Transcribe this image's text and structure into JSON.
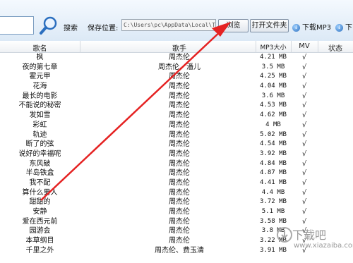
{
  "toolbar": {
    "search_label": "搜索",
    "path_label": "保存位置:",
    "path_value": "C:\\Users\\pc\\AppData\\Local\\Tem",
    "browse_label": "浏览",
    "open_folder_label": "打开文件夹",
    "download_mp3_label": "下载MP3",
    "download_mv_label": "下"
  },
  "columns": {
    "name": "歌名",
    "singer": "歌手",
    "size": "MP3大小",
    "mv": "MV",
    "status": "状态"
  },
  "songs": [
    {
      "name": "枫",
      "singer": "周杰伦",
      "size": "4.21 MB",
      "mv": "√"
    },
    {
      "name": "夜的第七章",
      "singer": "周杰伦、潘儿",
      "size": "3.5 MB",
      "mv": "√"
    },
    {
      "name": "霍元甲",
      "singer": "周杰伦",
      "size": "4.25 MB",
      "mv": "√"
    },
    {
      "name": "花海",
      "singer": "周杰伦",
      "size": "4.04 MB",
      "mv": "√"
    },
    {
      "name": "最长的电影",
      "singer": "周杰伦",
      "size": "3.6 MB",
      "mv": "√"
    },
    {
      "name": "不能说的秘密",
      "singer": "周杰伦",
      "size": "4.53 MB",
      "mv": "√"
    },
    {
      "name": "发如雪",
      "singer": "周杰伦",
      "size": "4.62 MB",
      "mv": "√"
    },
    {
      "name": "彩虹",
      "singer": "周杰伦",
      "size": "4 MB",
      "mv": "√"
    },
    {
      "name": "轨迹",
      "singer": "周杰伦",
      "size": "5.02 MB",
      "mv": "√"
    },
    {
      "name": "断了的弦",
      "singer": "周杰伦",
      "size": "4.54 MB",
      "mv": "√"
    },
    {
      "name": "说好的幸福呢",
      "singer": "周杰伦",
      "size": "3.92 MB",
      "mv": "√"
    },
    {
      "name": "东风破",
      "singer": "周杰伦",
      "size": "4.84 MB",
      "mv": "√"
    },
    {
      "name": "半岛铁盒",
      "singer": "周杰伦",
      "size": "4.87 MB",
      "mv": "√"
    },
    {
      "name": "我不配",
      "singer": "周杰伦",
      "size": "4.41 MB",
      "mv": "√"
    },
    {
      "name": "算什么男人",
      "singer": "周杰伦",
      "size": "4.4 MB",
      "mv": "√"
    },
    {
      "name": "甜甜的",
      "singer": "周杰伦",
      "size": "3.72 MB",
      "mv": "√"
    },
    {
      "name": "安静",
      "singer": "周杰伦",
      "size": "5.1 MB",
      "mv": "√"
    },
    {
      "name": "爱在西元前",
      "singer": "周杰伦",
      "size": "3.58 MB",
      "mv": "√"
    },
    {
      "name": "园游会",
      "singer": "周杰伦",
      "size": "3.8 MB",
      "mv": "√"
    },
    {
      "name": "本草纲目",
      "singer": "周杰伦",
      "size": "3.22 MB",
      "mv": "√"
    },
    {
      "name": "千里之外",
      "singer": "周杰伦、费玉清",
      "size": "3.91 MB",
      "mv": "√"
    }
  ],
  "watermark": {
    "text": "下载吧",
    "url": "www.xiazaiba.com"
  },
  "colors": {
    "arrow": "#e52222",
    "toolbar": "#dce9f6",
    "accent": "#2b6fbf"
  }
}
